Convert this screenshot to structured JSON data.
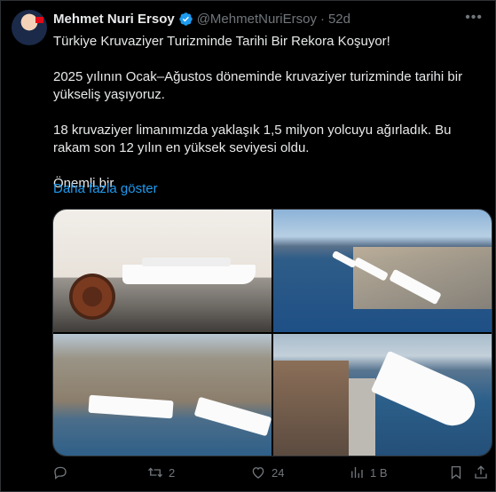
{
  "tweet": {
    "author_name": "Mehmet Nuri Ersoy",
    "handle": "@MehmetNuriErsoy",
    "separator": "·",
    "time": "52d",
    "more_icon": "ellipsis-icon",
    "text": "Türkiye Kruvaziyer Turizminde Tarihi Bir Rekora Koşuyor!\n\n2025 yılının Ocak–Ağustos döneminde kruvaziyer turizminde tarihi bir yükseliş yaşıyoruz.\n\n18 kruvaziyer limanımızda yaklaşık 1,5 milyon yolcuyu ağırladık. Bu rakam son 12 yılın en yüksek seviyesi oldu.\n\nÖnemli bir",
    "show_more": "Daha fazla göster",
    "verified_color": "#1d9bf0",
    "link_color": "#1d9bf0"
  },
  "actions": {
    "reply": {
      "icon": "reply-icon",
      "count": ""
    },
    "retweet": {
      "icon": "retweet-icon",
      "count": "2"
    },
    "like": {
      "icon": "heart-icon",
      "count": "24"
    },
    "views": {
      "icon": "analytics-icon",
      "count": "1 B"
    },
    "bookmark": {
      "icon": "bookmark-icon"
    },
    "share": {
      "icon": "share-icon"
    }
  }
}
